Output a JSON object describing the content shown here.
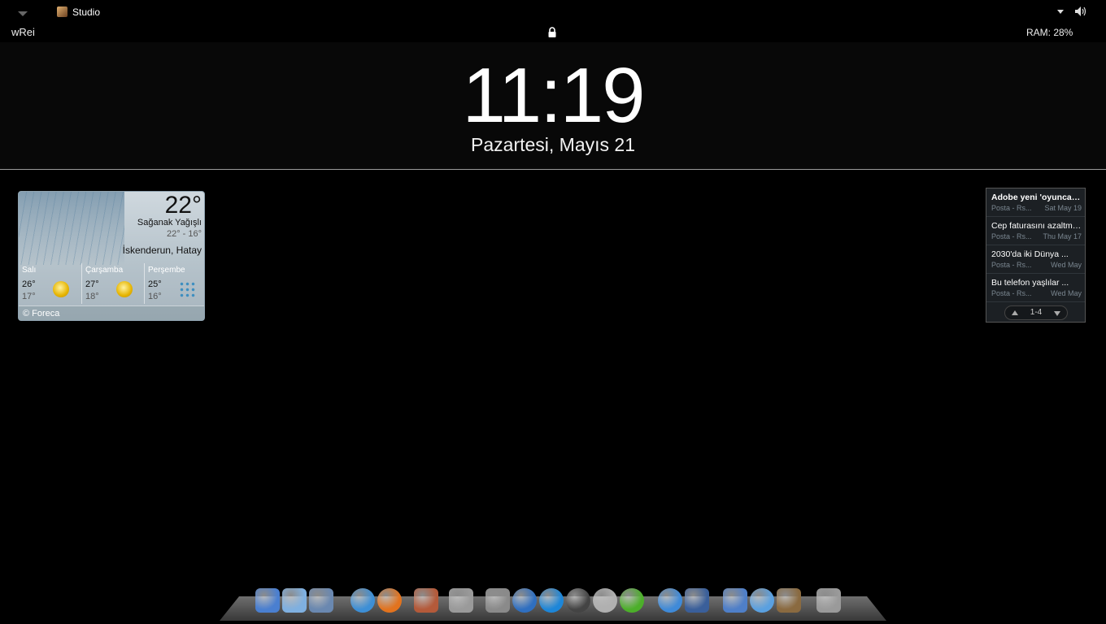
{
  "topbar": {
    "app_name": "Studio",
    "user_name": "wRei",
    "ram": "RAM: 28%"
  },
  "clock": {
    "time": "11:19",
    "date": "Pazartesi, Mayıs 21"
  },
  "weather": {
    "current_temp": "22°",
    "condition": "Sağanak Yağışlı",
    "range": "22°  -  16°",
    "location": "İskenderun, Hatay",
    "credit": "© Foreca",
    "days": [
      {
        "name": "Salı",
        "high": "26°",
        "low": "17°",
        "icon": "sun-icon"
      },
      {
        "name": "Çarşamba",
        "high": "27°",
        "low": "18°",
        "icon": "sun-icon"
      },
      {
        "name": "Perşembe",
        "high": "25°",
        "low": "16°",
        "icon": "showers-icon"
      }
    ]
  },
  "news": {
    "items": [
      {
        "title": "Adobe yeni 'oyuncağını...",
        "source": "Posta - Rs...",
        "date": "Sat May 19"
      },
      {
        "title": "Cep faturasını azaltmak...",
        "source": "Posta - Rs...",
        "date": "Thu May 17"
      },
      {
        "title": "2030'da iki Dünya ...",
        "source": "Posta - Rs...",
        "date": "Wed May"
      },
      {
        "title": "Bu telefon yaşlılar ...",
        "source": "Posta - Rs...",
        "date": "Wed May"
      }
    ],
    "range": "1-4"
  },
  "dock": {
    "items": [
      {
        "name": "finder-icon",
        "color": "#4a7fd0"
      },
      {
        "name": "display-icon",
        "color": "#7fb0e0"
      },
      {
        "name": "migration-icon",
        "color": "#6a88b0"
      },
      {
        "name": "safari-icon",
        "color": "#3d8fd6"
      },
      {
        "name": "firefox-icon",
        "color": "#e2731e"
      },
      {
        "name": "photos-icon",
        "color": "#b45a3a"
      },
      {
        "name": "gamepad-icon",
        "color": "#9a9a9a"
      },
      {
        "name": "system-preferences-icon",
        "color": "#8a8a8a"
      },
      {
        "name": "sync-icon",
        "color": "#2f6fc0"
      },
      {
        "name": "quicktime-icon",
        "color": "#1d86d8"
      },
      {
        "name": "dashboard-icon",
        "color": "#444444"
      },
      {
        "name": "back-icon",
        "color": "#b0b0b0"
      },
      {
        "name": "utorrent-icon",
        "color": "#4caf2a"
      },
      {
        "name": "ichat-icon",
        "color": "#3f8ad8"
      },
      {
        "name": "movie-icon",
        "color": "#3a5f9a"
      },
      {
        "name": "rocket-icon",
        "color": "#4f7fc8"
      },
      {
        "name": "itunes-icon",
        "color": "#5aa0e0"
      },
      {
        "name": "iphoto-icon",
        "color": "#8a6a40"
      },
      {
        "name": "trash-icon",
        "color": "#9a9a9a"
      }
    ]
  }
}
